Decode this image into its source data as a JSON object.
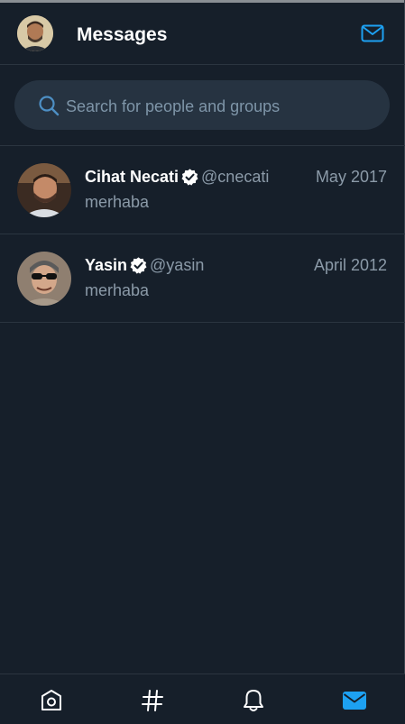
{
  "header": {
    "title": "Messages",
    "compose_icon": "envelope-icon",
    "avatar_icon": "avatar"
  },
  "search": {
    "placeholder": "Search for people and groups",
    "value": "",
    "icon": "search-icon"
  },
  "conversations": [
    {
      "name": "Cihat Necati",
      "handle": "@cnecati",
      "date": "May 2017",
      "message": "merhaba",
      "verified": true
    },
    {
      "name": "Yasin",
      "handle": "@yasin",
      "date": "April 2012",
      "message": "merhaba",
      "verified": true
    }
  ],
  "bottom_nav": {
    "items": [
      "home-icon",
      "hashtag-icon",
      "bell-icon",
      "envelope-icon"
    ],
    "active": "envelope-icon"
  },
  "colors": {
    "background": "#161f2a",
    "accent": "#1da1f2",
    "muted_text": "#8b9aa8",
    "search_bg": "#263341",
    "divider": "#2b3540"
  }
}
